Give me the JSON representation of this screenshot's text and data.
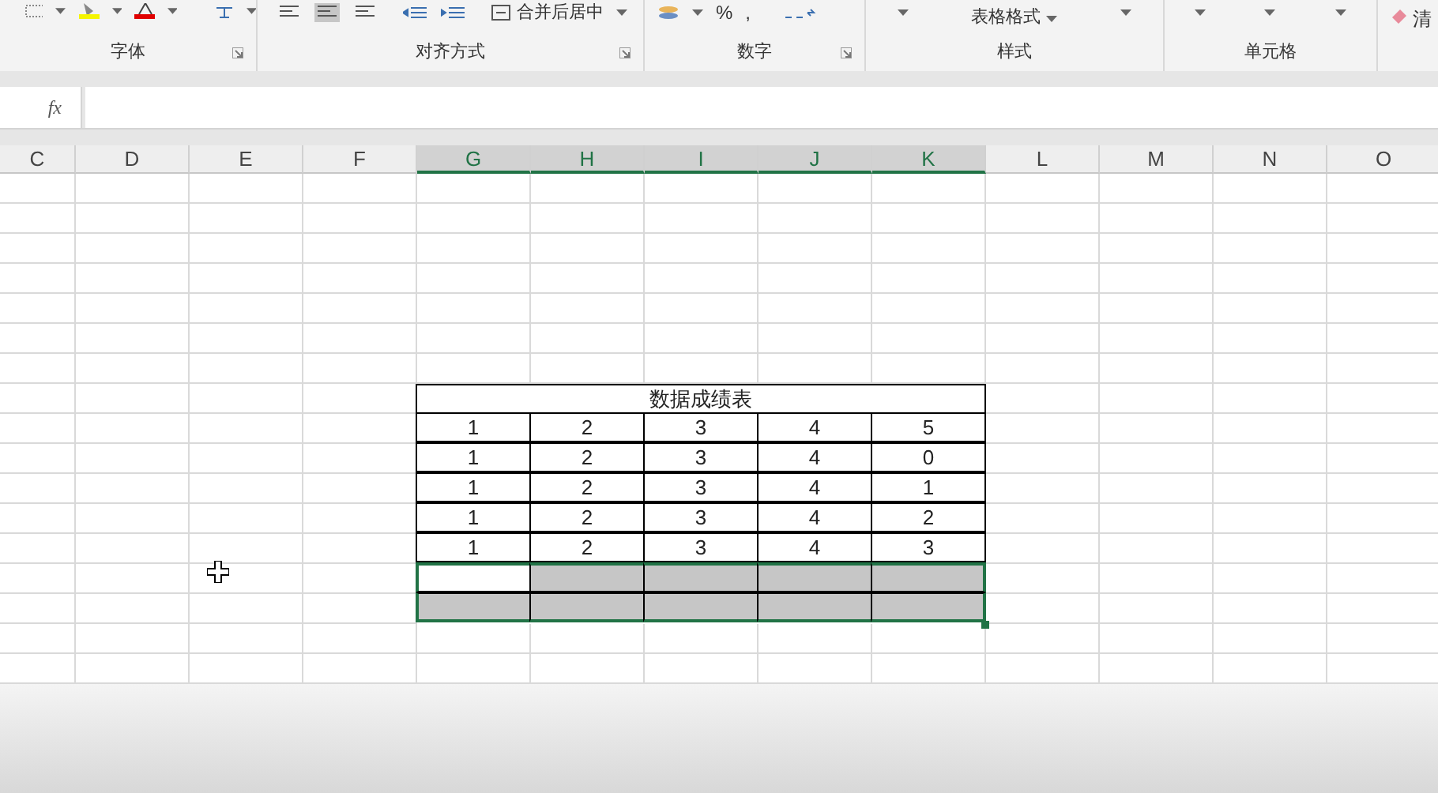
{
  "ribbon": {
    "groups": [
      {
        "label": "字体"
      },
      {
        "label": "对齐方式"
      },
      {
        "label": "数字"
      },
      {
        "label": "样式"
      },
      {
        "label": "单元格"
      }
    ],
    "merge_button": "合并后居中",
    "percent": "%",
    "comma": ",",
    "table_format": "表格格式",
    "clear": "清"
  },
  "formula_bar": {
    "fx": "fx"
  },
  "columns": [
    {
      "label": "C",
      "selected": false
    },
    {
      "label": "D",
      "selected": false
    },
    {
      "label": "E",
      "selected": false
    },
    {
      "label": "F",
      "selected": false
    },
    {
      "label": "G",
      "selected": true
    },
    {
      "label": "H",
      "selected": true
    },
    {
      "label": "I",
      "selected": true
    },
    {
      "label": "J",
      "selected": true
    },
    {
      "label": "K",
      "selected": true
    },
    {
      "label": "L",
      "selected": false
    },
    {
      "label": "M",
      "selected": false
    },
    {
      "label": "N",
      "selected": false
    },
    {
      "label": "O",
      "selected": false
    }
  ],
  "table": {
    "title": "数据成绩表",
    "rows": [
      [
        "1",
        "2",
        "3",
        "4",
        "5"
      ],
      [
        "1",
        "2",
        "3",
        "4",
        "0"
      ],
      [
        "1",
        "2",
        "3",
        "4",
        "1"
      ],
      [
        "1",
        "2",
        "3",
        "4",
        "2"
      ],
      [
        "1",
        "2",
        "3",
        "4",
        "3"
      ]
    ],
    "selection_rows": [
      [
        {
          "active": true
        },
        {
          "active": false
        },
        {
          "active": false
        },
        {
          "active": false
        },
        {
          "active": false
        }
      ],
      [
        {
          "active": false
        },
        {
          "active": false
        },
        {
          "active": false
        },
        {
          "active": false
        },
        {
          "active": false
        }
      ]
    ]
  }
}
